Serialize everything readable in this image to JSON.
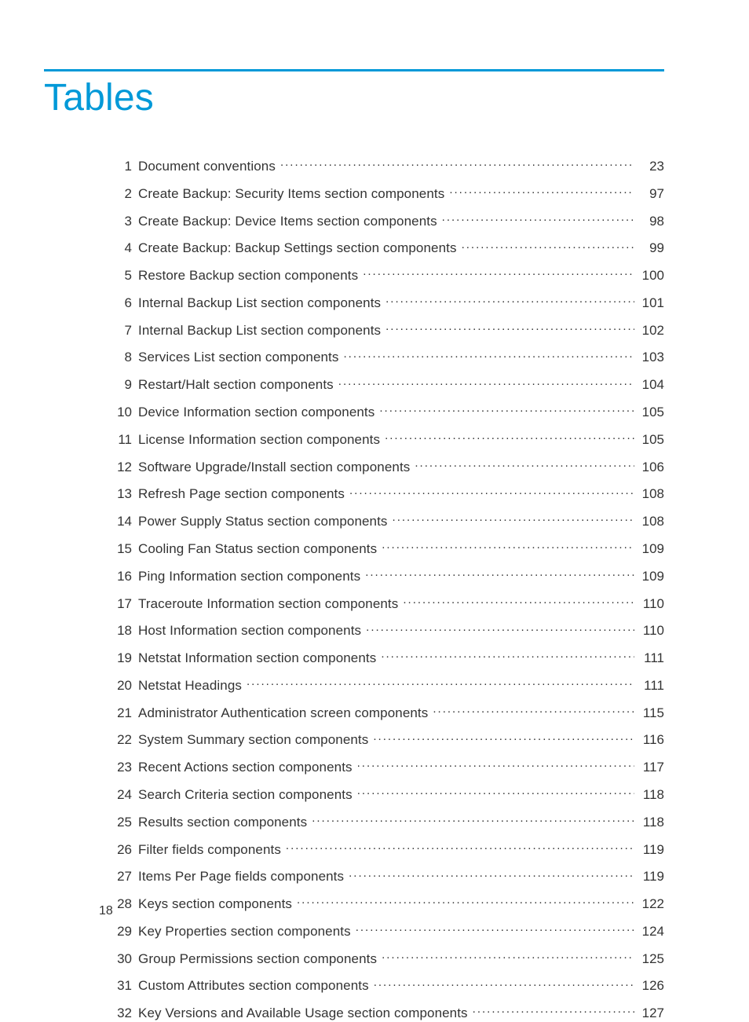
{
  "title": "Tables",
  "page_number": "18",
  "entries": [
    {
      "n": "1",
      "label": "Document conventions",
      "page": "23"
    },
    {
      "n": "2",
      "label": "Create Backup: Security Items section components",
      "page": "97"
    },
    {
      "n": "3",
      "label": "Create Backup: Device Items section components",
      "page": "98"
    },
    {
      "n": "4",
      "label": "Create Backup: Backup Settings section components",
      "page": "99"
    },
    {
      "n": "5",
      "label": "Restore Backup section components",
      "page": "100"
    },
    {
      "n": "6",
      "label": "Internal Backup List section components",
      "page": "101"
    },
    {
      "n": "7",
      "label": "Internal Backup List section components",
      "page": "102"
    },
    {
      "n": "8",
      "label": "Services List section components",
      "page": "103"
    },
    {
      "n": "9",
      "label": "Restart/Halt section components",
      "page": "104"
    },
    {
      "n": "10",
      "label": "Device Information section components",
      "page": "105"
    },
    {
      "n": "11",
      "label": "License Information section components",
      "page": "105"
    },
    {
      "n": "12",
      "label": "Software Upgrade/Install section components",
      "page": "106"
    },
    {
      "n": "13",
      "label": "Refresh Page section components",
      "page": "108"
    },
    {
      "n": "14",
      "label": "Power Supply Status section components",
      "page": "108"
    },
    {
      "n": "15",
      "label": "Cooling Fan Status section components",
      "page": "109"
    },
    {
      "n": "16",
      "label": "Ping Information section components",
      "page": "109"
    },
    {
      "n": "17",
      "label": "Traceroute Information section components",
      "page": "110"
    },
    {
      "n": "18",
      "label": "Host Information section components",
      "page": "110"
    },
    {
      "n": "19",
      "label": "Netstat Information section components",
      "page": "111"
    },
    {
      "n": "20",
      "label": "Netstat Headings",
      "page": "111"
    },
    {
      "n": "21",
      "label": "Administrator Authentication screen components",
      "page": "115"
    },
    {
      "n": "22",
      "label": "System Summary section components",
      "page": "116"
    },
    {
      "n": "23",
      "label": "Recent Actions section components",
      "page": "117"
    },
    {
      "n": "24",
      "label": "Search Criteria section components",
      "page": "118"
    },
    {
      "n": "25",
      "label": "Results section components",
      "page": "118"
    },
    {
      "n": "26",
      "label": "Filter fields components",
      "page": "119"
    },
    {
      "n": "27",
      "label": "Items Per Page fields components",
      "page": "119"
    },
    {
      "n": "28",
      "label": "Keys section components",
      "page": "122"
    },
    {
      "n": "29",
      "label": "Key Properties section components",
      "page": "124"
    },
    {
      "n": "30",
      "label": "Group Permissions section components",
      "page": "125"
    },
    {
      "n": "31",
      "label": "Custom Attributes section components",
      "page": "126"
    },
    {
      "n": "32",
      "label": "Key Versions and Available Usage section components",
      "page": "127"
    }
  ]
}
